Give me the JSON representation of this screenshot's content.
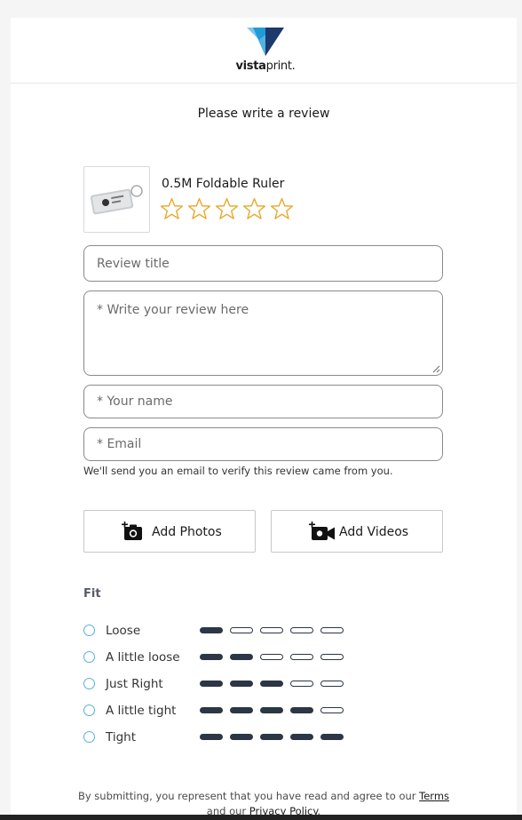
{
  "brand": {
    "name_bold": "vista",
    "name_light": "print",
    "suffix": "."
  },
  "page_title": "Please write a review",
  "product": {
    "name": "0.5M Foldable Ruler",
    "rating_max": 5,
    "rating": 0
  },
  "form": {
    "review_title_placeholder": "Review title",
    "review_body_placeholder": "* Write your review here",
    "name_placeholder": "* Your name",
    "email_placeholder": "* Email",
    "email_note": "We'll send you an email to verify this review came from you."
  },
  "media": {
    "add_photos_label": "Add Photos",
    "add_videos_label": "Add Videos"
  },
  "fit": {
    "heading": "Fit",
    "options": [
      {
        "label": "Loose",
        "level": 1
      },
      {
        "label": "A little loose",
        "level": 2
      },
      {
        "label": "Just Right",
        "level": 3
      },
      {
        "label": "A little tight",
        "level": 4
      },
      {
        "label": "Tight",
        "level": 5
      }
    ]
  },
  "footer": {
    "text_before": "By submitting, you represent that you have read and agree to our",
    "terms_label": "Terms",
    "and_our": "and our",
    "privacy_label": "Privacy Policy",
    "period": "."
  },
  "colors": {
    "accent_radio": "#5ab0d8",
    "star_outline": "#e8a92b",
    "bar_dark": "#2c3645",
    "logo_blue": "#1f9bd7",
    "logo_navy": "#1c3a6b"
  }
}
